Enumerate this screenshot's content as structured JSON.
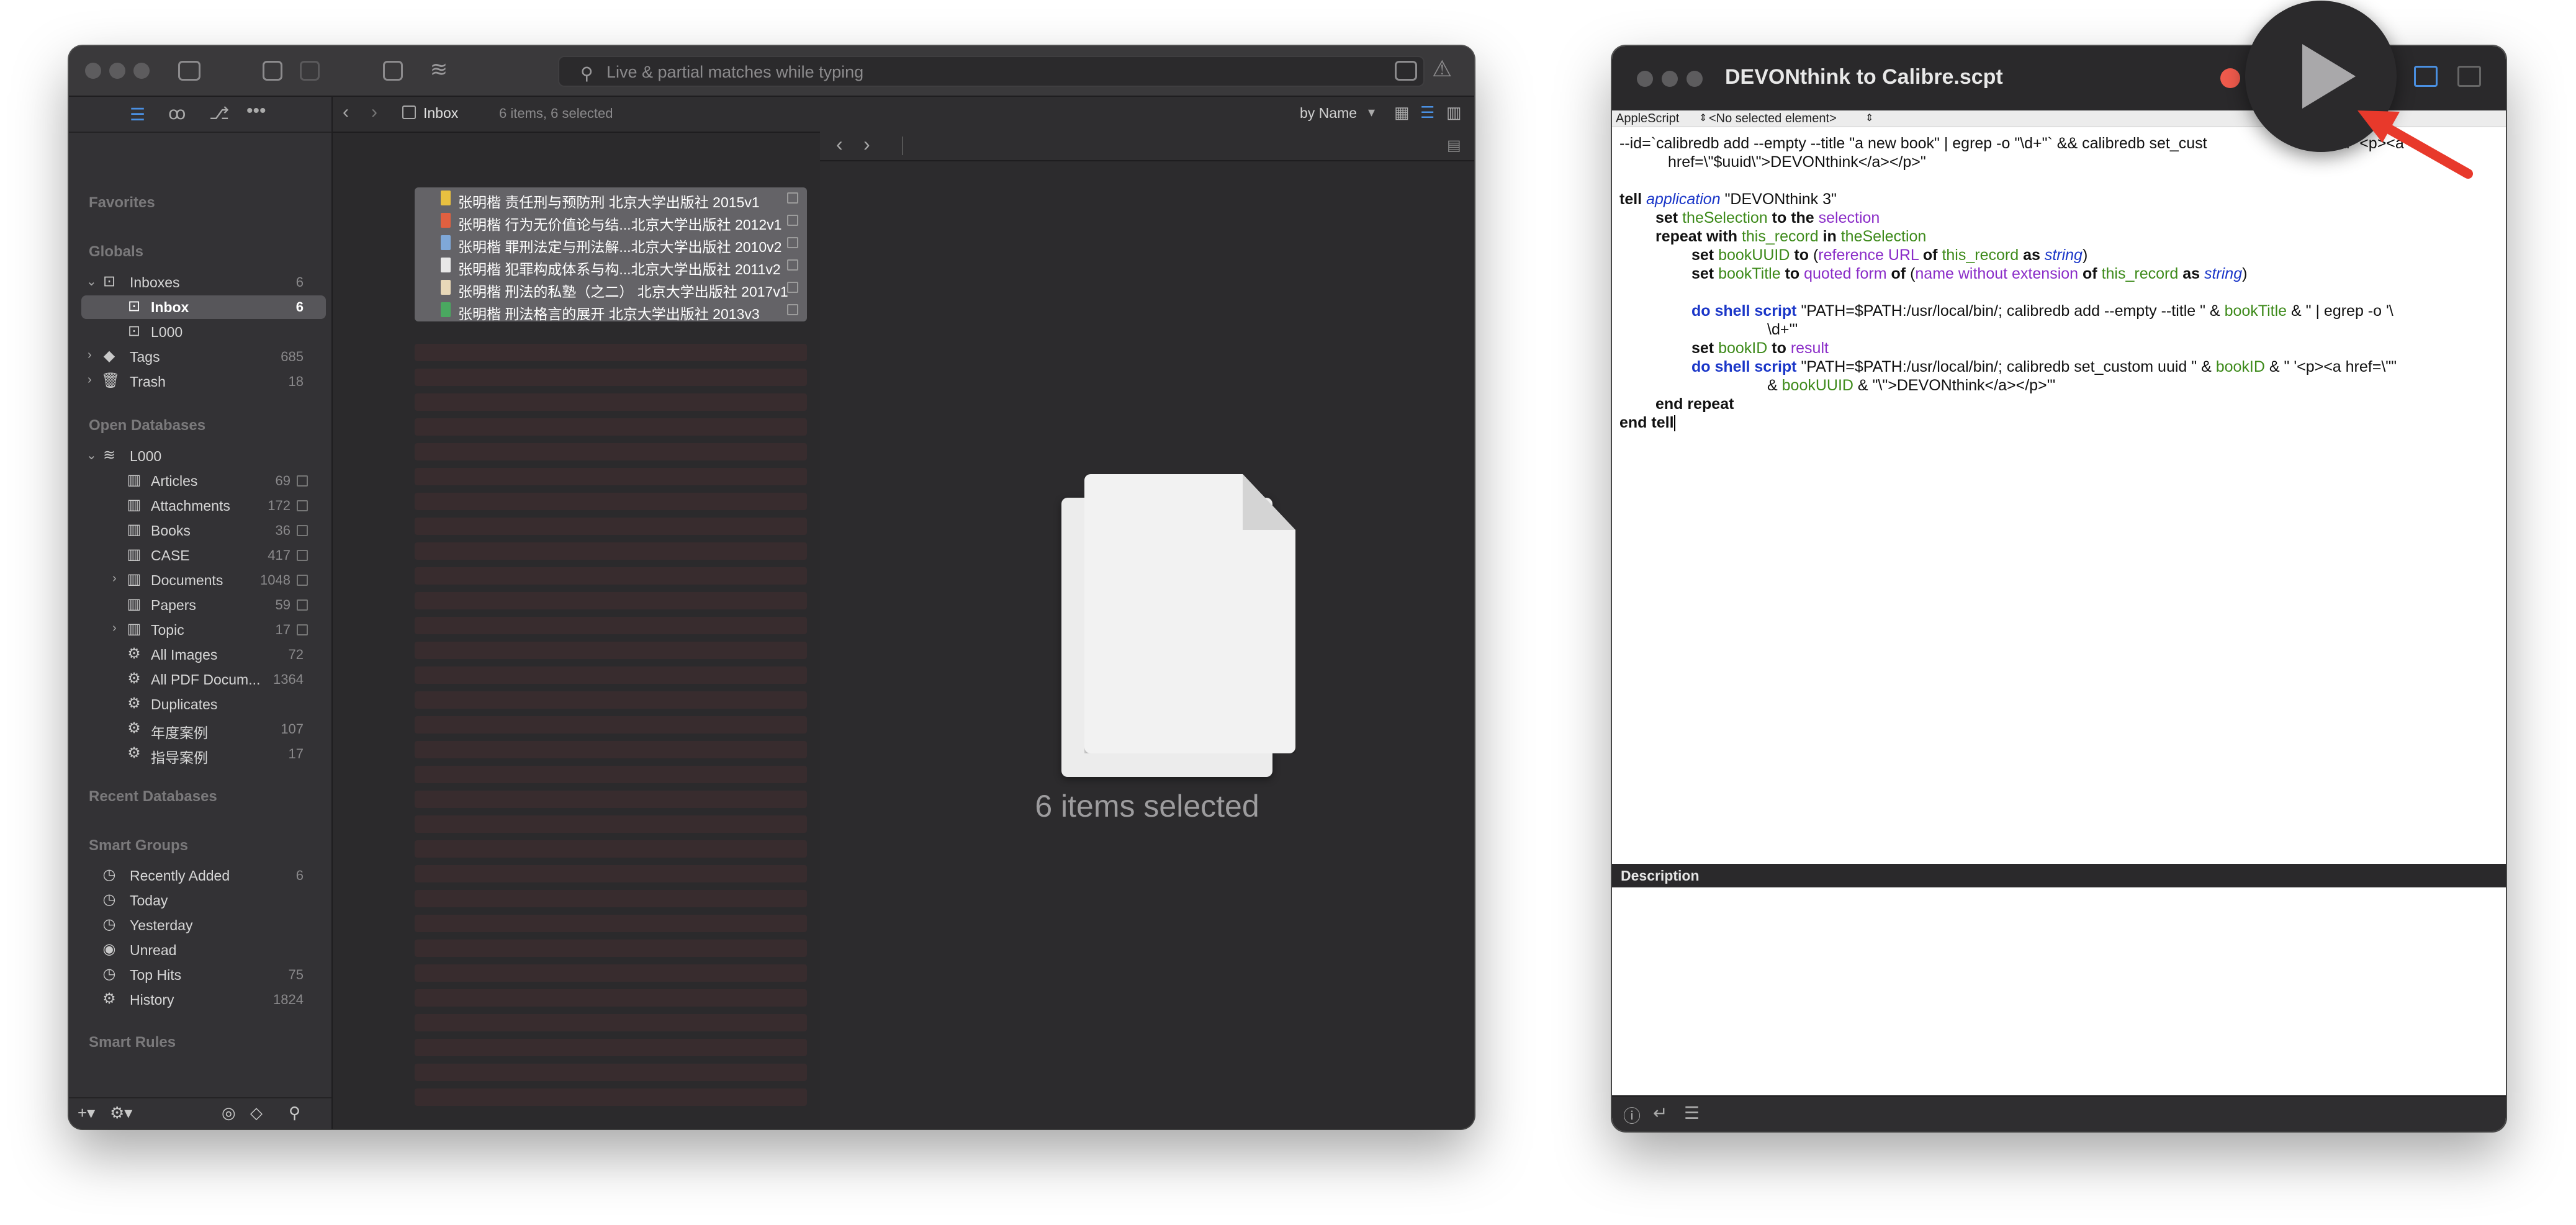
{
  "devonthink": {
    "search_placeholder": "Live & partial matches while typing",
    "sidebar": {
      "sections": {
        "favorites": "Favorites",
        "globals": "Globals",
        "open_databases": "Open Databases",
        "recent_databases": "Recent Databases",
        "smart_groups": "Smart Groups",
        "smart_rules": "Smart Rules"
      },
      "globals": [
        {
          "label": "Inboxes",
          "count": "6"
        },
        {
          "label": "Inbox",
          "count": "6"
        },
        {
          "label": "L000",
          "count": ""
        },
        {
          "label": "Tags",
          "count": "685"
        },
        {
          "label": "Trash",
          "count": "18"
        }
      ],
      "databases": [
        {
          "label": "L000",
          "count": ""
        },
        {
          "label": "Articles",
          "count": "69"
        },
        {
          "label": "Attachments",
          "count": "172"
        },
        {
          "label": "Books",
          "count": "36"
        },
        {
          "label": "CASE",
          "count": "417"
        },
        {
          "label": "Documents",
          "count": "1048"
        },
        {
          "label": "Papers",
          "count": "59"
        },
        {
          "label": "Topic",
          "count": "17"
        },
        {
          "label": "All Images",
          "count": "72"
        },
        {
          "label": "All PDF Docum...",
          "count": "1364"
        },
        {
          "label": "Duplicates",
          "count": ""
        },
        {
          "label": "年度案例",
          "count": "107"
        },
        {
          "label": "指导案例",
          "count": "17"
        }
      ],
      "smart_groups": [
        {
          "label": "Recently Added",
          "count": "6"
        },
        {
          "label": "Today",
          "count": ""
        },
        {
          "label": "Yesterday",
          "count": ""
        },
        {
          "label": "Unread",
          "count": ""
        },
        {
          "label": "Top Hits",
          "count": "75"
        },
        {
          "label": "History",
          "count": "1824"
        }
      ]
    },
    "nav": {
      "location": "Inbox",
      "status": "6 items, 6 selected",
      "sort": "by Name"
    },
    "items": [
      "张明楷 责任刑与预防刑 北京大学出版社 2015v1",
      "张明楷 行为无价值论与结...北京大学出版社 2012v1",
      "张明楷 罪刑法定与刑法解...北京大学出版社 2010v2",
      "张明楷 犯罪构成体系与构...北京大学出版社 2011v2",
      "张明楷 刑法的私塾（之二） 北京大学出版社 2017v1",
      "张明楷 刑法格言的展开 北京大学出版社 2013v3"
    ],
    "preview_text": "6 items selected"
  },
  "script_editor": {
    "title": "DEVONthink to Calibre.scpt",
    "language": "AppleScript",
    "element_selector": "<No selected element>",
    "description_label": "Description",
    "code": {
      "l1": "--id=`calibredb add --empty --title \"a new book\" | egrep -o \"\\d+\"` && calibredb set_cust",
      "l1b": "id $id \"<p><a",
      "l2": "href=\\\"$uuid\\\">DEVONthink</a></p>\"",
      "tell": "tell",
      "application": "application",
      "app_name": "\"DEVONthink 3\"",
      "set": "set",
      "theSelection": "theSelection",
      "to_the": "to the",
      "selection": "selection",
      "repeat_with": "repeat with",
      "this_record": "this_record",
      "in": "in",
      "bookUUID": "bookUUID",
      "to": "to",
      "reference_URL": "reference URL",
      "of": "of",
      "as": "as",
      "string": "string",
      "bookTitle": "bookTitle",
      "quoted_form": "quoted form",
      "name_without_extension": "name without extension",
      "do_shell_script": "do shell script",
      "s1": "\"PATH=$PATH:/usr/local/bin/; calibredb add --empty --title \" &",
      "s1b": "& \" | egrep -o '\\",
      "s1c": "\\d+'\"",
      "bookID": "bookID",
      "result": "result",
      "s2": "\"PATH=$PATH:/usr/local/bin/; calibredb set_custom uuid \" &",
      "s2b": "& \" '<p><a href=\\\"\"",
      "s2c": "&",
      "s2d": "& \"\\\">DEVONthink</a></p>'\"",
      "end_repeat": "end repeat",
      "end_tell": "end tell",
      "open_paren": "(",
      "close_paren": ")"
    }
  },
  "colors": {
    "accent_arrow": "#e8392b",
    "close_red": "#ee5a4c",
    "pane_blue": "#4a90e2"
  }
}
